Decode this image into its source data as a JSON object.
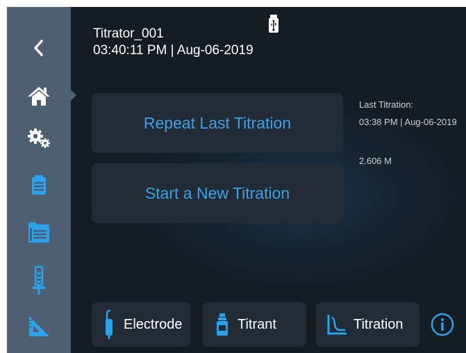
{
  "sidebar": {
    "items": [
      {
        "icon": "back-arrow-icon"
      },
      {
        "icon": "home-icon",
        "active": true
      },
      {
        "icon": "gears-icon"
      },
      {
        "icon": "clipboard-icon"
      },
      {
        "icon": "results-folder-icon"
      },
      {
        "icon": "burette-icon"
      },
      {
        "icon": "triangle-ruler-icon"
      }
    ]
  },
  "header": {
    "device_name": "Titrator_001",
    "datetime": "03:40:11 PM | Aug-06-2019",
    "usb_icon": "usb-drive-icon"
  },
  "main": {
    "repeat_button": "Repeat Last Titration",
    "new_button": "Start a New Titration"
  },
  "last_titration": {
    "label": "Last Titration:",
    "time": "03:38 PM | Aug-06-2019",
    "result": "2.606 M"
  },
  "bottom_tabs": {
    "electrode": "Electrode",
    "titrant": "Titrant",
    "titration": "Titration",
    "info_icon": "info-icon"
  },
  "colors": {
    "sidebar": "#4d5f73",
    "background": "#16232f",
    "button": "#212c37",
    "accent": "#3ea1e6",
    "icon_blue": "#2aa2ee",
    "text": "#ffffff"
  }
}
